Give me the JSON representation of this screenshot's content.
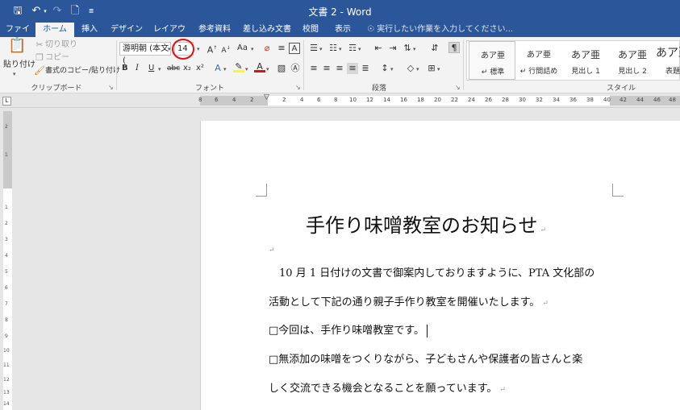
{
  "window": {
    "title": "文書 2 - Word"
  },
  "qat": {
    "save_icon": "save-icon",
    "undo_icon": "undo-icon",
    "redo_icon": "redo-icon",
    "new_icon": "new-document-icon"
  },
  "tabs": [
    {
      "label": "ファイル",
      "active": false
    },
    {
      "label": "ホーム",
      "active": true
    },
    {
      "label": "挿入",
      "active": false
    },
    {
      "label": "デザイン",
      "active": false
    },
    {
      "label": "レイアウト",
      "active": false
    },
    {
      "label": "参考資料",
      "active": false
    },
    {
      "label": "差し込み文書",
      "active": false
    },
    {
      "label": "校閲",
      "active": false
    },
    {
      "label": "表示",
      "active": false
    }
  ],
  "tell_me": "実行したい作業を入力してください...",
  "clipboard": {
    "paste": "貼り付け",
    "cut": "切り取り",
    "copy": "コピー",
    "format_painter": "書式のコピー/貼り付け",
    "group_label": "クリップボード"
  },
  "font": {
    "name": "游明朝 (本文(",
    "size": "14",
    "change_case": "Aa",
    "bold": "B",
    "italic": "I",
    "underline": "U",
    "strikethrough": "abc",
    "subscript": "x₂",
    "superscript": "x²",
    "group_label": "フォント"
  },
  "paragraph": {
    "group_label": "段落"
  },
  "styles": {
    "items": [
      {
        "sample": "あア亜",
        "name": "標準",
        "selected": true
      },
      {
        "sample": "あア亜",
        "name": "行間詰め",
        "selected": false
      },
      {
        "sample": "あア亜",
        "name": "見出し 1",
        "selected": false
      },
      {
        "sample": "あア亜",
        "name": "見出し 2",
        "selected": false
      },
      {
        "sample": "あア亜",
        "name": "表題",
        "selected": false
      }
    ],
    "group_label": "スタイル"
  },
  "ruler": {
    "h_ticks": [
      "8",
      "6",
      "4",
      "2",
      "2",
      "4",
      "6",
      "8",
      "10",
      "12",
      "14",
      "16",
      "18",
      "20",
      "22",
      "24",
      "26",
      "28",
      "30",
      "32",
      "34",
      "36",
      "38",
      "40",
      "42",
      "44",
      "46",
      "48"
    ],
    "v_ticks": [
      "2",
      "1",
      "1",
      "2",
      "3",
      "4",
      "5",
      "6",
      "7",
      "8",
      "9",
      "10",
      "11",
      "12",
      "13",
      "14"
    ]
  },
  "document": {
    "title": "手作り味噌教室のお知らせ",
    "paragraphs": [
      "10 月 1 日付けの文書で御案内しておりますように、PTA 文化部の",
      "活動として下記の通り親子手作り教室を開催いたします。",
      "□今回は、手作り味噌教室です。",
      "□無添加の味噌をつくりながら、子どもさんや保護者の皆さんと楽",
      "しく交流できる機会となることを願っています。"
    ]
  },
  "colors": {
    "accent": "#2b579a",
    "highlight_annotation": "#e01010",
    "ribbon_bg": "#f3f3f3"
  }
}
